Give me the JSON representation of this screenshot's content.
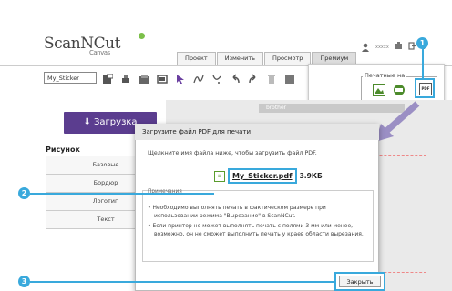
{
  "app": {
    "logo_text": "ScanNCut",
    "logo_sub": "Canvas",
    "user_name": "xxxxx"
  },
  "tabs": [
    {
      "label": "Проект"
    },
    {
      "label": "Изменить"
    },
    {
      "label": "Просмотр"
    },
    {
      "label": "Премиум"
    }
  ],
  "toolbar": {
    "project_name": "My_Sticker"
  },
  "print_popup": {
    "label": "Печатные на"
  },
  "sidebar": {
    "upload_label": "Загрузка",
    "pattern_title": "Рисунок",
    "pattern_tabs": [
      {
        "label": "Базовые"
      },
      {
        "label": "Бордюр"
      },
      {
        "label": "Логотип"
      },
      {
        "label": "Текст"
      }
    ]
  },
  "canvas": {
    "brand_text": "brother"
  },
  "dialog": {
    "title": "Загрузите файл PDF для печати",
    "instruction": "Щелкните имя файла ниже, чтобы загрузить файл PDF.",
    "file_name": "My_Sticker.pdf",
    "file_size": "3.9КБ",
    "notes_header": "Примечания",
    "notes": [
      "Необходимо выполнять печать в фактическом размере при использовании режима \"Вырезание\" в ScanNCut.",
      "Если принтер не может выполнять печать с полями 3 мм или менее, возможно, он не сможет выполнить печать у краев области вырезания."
    ],
    "close_label": "Закрыть"
  },
  "callouts": {
    "one": "1",
    "two": "2",
    "three": "3"
  },
  "colors": {
    "accent": "#39a9dc",
    "upload": "#5b3d8f"
  }
}
